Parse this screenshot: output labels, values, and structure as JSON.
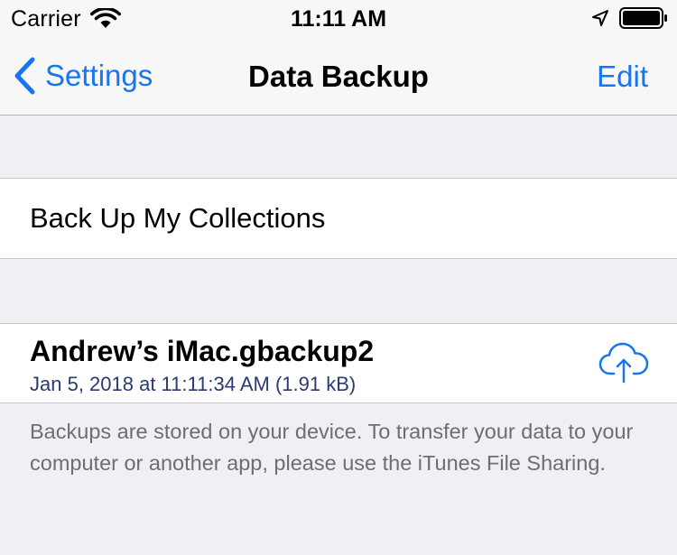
{
  "status_bar": {
    "carrier": "Carrier",
    "time": "11:11 AM",
    "icons": [
      "wifi-icon",
      "location-arrow-icon",
      "battery-icon"
    ]
  },
  "nav": {
    "back_label": "Settings",
    "title": "Data Backup",
    "edit_label": "Edit",
    "tint_color": "#1875f0"
  },
  "sections": {
    "collections_label": "Back Up My Collections",
    "backup": {
      "name": "Andrew’s iMac.gbackup2",
      "details": "Jan 5, 2018 at 11:11:34 AM (1.91 kB)",
      "action_icon": "cloud-upload-icon"
    },
    "footer": "Backups are stored on your device. To transfer your data to your computer or another app, please use the iTunes File Sharing."
  }
}
